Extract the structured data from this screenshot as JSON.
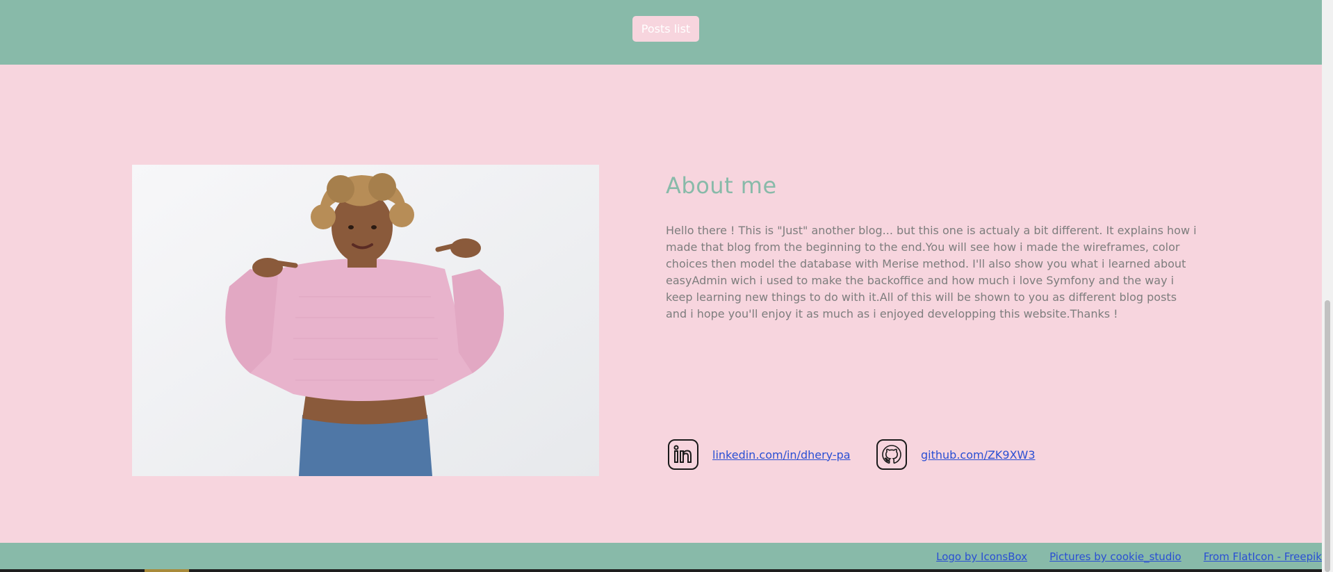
{
  "header": {
    "posts_button_label": "Posts list"
  },
  "about": {
    "title": "About me",
    "text": "Hello there ! This is \"Just\" another blog... but this one is actualy a bit different. It explains how i made that blog from the beginning to the end.You will see how i made the wireframes, color choices then model the database with Merise method. I'll also show you what i learned about easyAdmin wich i used to make the backoffice and how much i love Symfony and the way i keep learning new things to do with it.All of this will be shown to you as different blog posts and i hope you'll enjoy it as much as i enjoyed developping this website.Thanks !"
  },
  "social": {
    "linkedin": {
      "icon": "linkedin-icon",
      "label": "linkedin.com/in/dhery-pa"
    },
    "github": {
      "icon": "github-icon",
      "label": "github.com/ZK9XW3"
    }
  },
  "footer": {
    "links": [
      "Logo by IconsBox",
      "Pictures by cookie_studio",
      "From FlatIcon - Freepik"
    ]
  },
  "colors": {
    "header_bg": "#88baa9",
    "page_bg": "#f7d5de",
    "accent_title": "#88baa9",
    "link": "#2a4fd3"
  }
}
